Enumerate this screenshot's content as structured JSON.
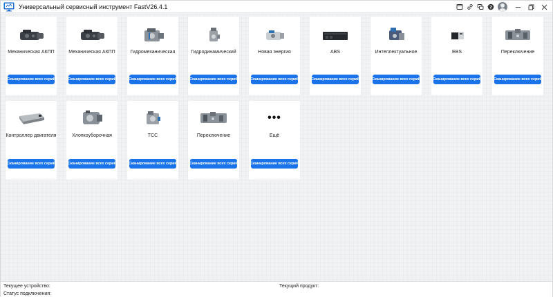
{
  "app": {
    "title": "Универсальный сервисный инструмент FastV26.4.1"
  },
  "title_icons": [
    "info-icon",
    "link-icon",
    "chat-icon",
    "help-icon",
    "user-avatar",
    "minimize-icon",
    "restore-icon",
    "close-icon"
  ],
  "cards": [
    {
      "label": "Механическая АКПП",
      "button": "Сканирование всех серий",
      "image": "gearbox-image"
    },
    {
      "label": "Механическая АКПП",
      "button": "Сканирование всех серий",
      "image": "gearbox-image"
    },
    {
      "label": "Гидромеханическая",
      "button": "Сканирование всех серий",
      "image": "hydromechanical-image"
    },
    {
      "label": "Гидродинамический",
      "button": "Сканирование всех серий",
      "image": "hydrodynamic-image"
    },
    {
      "label": "Новая энергия",
      "button": "Сканирование всех серий",
      "image": "motor-image"
    },
    {
      "label": "ABS",
      "button": "Сканирование всех серий",
      "image": "abs-module-image"
    },
    {
      "label": "Интеллектуальное",
      "button": "Сканирование всех серий",
      "image": "intelligent-image"
    },
    {
      "label": "EBS",
      "button": "Сканирование всех серий",
      "image": "ebs-image"
    },
    {
      "label": "Переключение",
      "button": "Сканирование всех серий",
      "image": "shift-image"
    },
    {
      "label": "Контроллер двигателя",
      "button": "Сканирование всех серий",
      "image": "controller-image"
    },
    {
      "label": "Хлопкоуборочная",
      "button": "Сканирование всех серий",
      "image": "cotton-picker-image"
    },
    {
      "label": "TCC",
      "button": "Сканирование всех серий",
      "image": "tcc-image"
    },
    {
      "label": "Переключение",
      "button": "Сканирование всех серий",
      "image": "shift-image"
    },
    {
      "label": "Ещё",
      "button": "Сканирование всех серий",
      "image": "more-icon"
    }
  ],
  "more_glyph": "•••",
  "status": {
    "current_device_label": "Текущее устройство:",
    "current_device_value": "",
    "current_product_label": "Текущий продукт:",
    "current_product_value": "",
    "connection_label": "Статус подключения:",
    "connection_value": ""
  },
  "colors": {
    "accent": "#1a73e8",
    "logo": "#1e6fd9"
  }
}
